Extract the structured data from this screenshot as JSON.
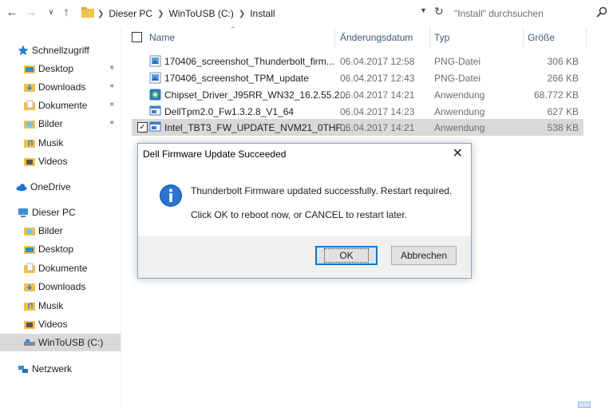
{
  "address_bar": {
    "crumbs": [
      "Dieser PC",
      "WinToUSB (C:)",
      "Install"
    ],
    "search_placeholder": "\"Install\" durchsuchen"
  },
  "sidebar": {
    "quick_access": "Schnellzugriff",
    "quick_items": [
      {
        "label": "Desktop",
        "pinned": true
      },
      {
        "label": "Downloads",
        "pinned": true
      },
      {
        "label": "Dokumente",
        "pinned": true
      },
      {
        "label": "Bilder",
        "pinned": true
      },
      {
        "label": "Musik",
        "pinned": false
      },
      {
        "label": "Videos",
        "pinned": false
      }
    ],
    "onedrive": "OneDrive",
    "this_pc": "Dieser PC",
    "pc_items": [
      "Bilder",
      "Desktop",
      "Dokumente",
      "Downloads",
      "Musik",
      "Videos",
      "WinToUSB (C:)"
    ],
    "selected_item": "WinToUSB (C:)",
    "network": "Netzwerk"
  },
  "columns": {
    "name": "Name",
    "date": "Änderungsdatum",
    "type": "Typ",
    "size": "Größe"
  },
  "files": [
    {
      "name": "170406_screenshot_Thunderbolt_firm...",
      "date": "06.04.2017 12:58",
      "type": "PNG-Datei",
      "size": "306 KB",
      "icon": "png-file-icon",
      "selected": false
    },
    {
      "name": "170406_screenshot_TPM_update",
      "date": "06.04.2017 12:43",
      "type": "PNG-Datei",
      "size": "266 KB",
      "icon": "png-file-icon",
      "selected": false
    },
    {
      "name": "Chipset_Driver_J95RR_WN32_16.2.55.2...",
      "date": "06.04.2017 14:21",
      "type": "Anwendung",
      "size": "68.772 KB",
      "icon": "installer-icon",
      "selected": false
    },
    {
      "name": "DellTpm2.0_Fw1.3.2.8_V1_64",
      "date": "06.04.2017 14:23",
      "type": "Anwendung",
      "size": "627 KB",
      "icon": "exe-file-icon",
      "selected": false
    },
    {
      "name": "Intel_TBT3_FW_UPDATE_NVM21_0THF...",
      "date": "06.04.2017 14:21",
      "type": "Anwendung",
      "size": "538 KB",
      "icon": "exe-file-icon",
      "selected": true
    }
  ],
  "dialog": {
    "title": "Dell Firmware Update Succeeded",
    "message1": "Thunderbolt Firmware updated successfully. Restart required.",
    "message2": "Click OK to reboot now, or CANCEL to restart later.",
    "ok_label": "OK",
    "cancel_label": "Abbrechen"
  },
  "colors": {
    "selection": "#d9d9d9",
    "accent": "#0078d7",
    "folder": "#f2c14e"
  }
}
